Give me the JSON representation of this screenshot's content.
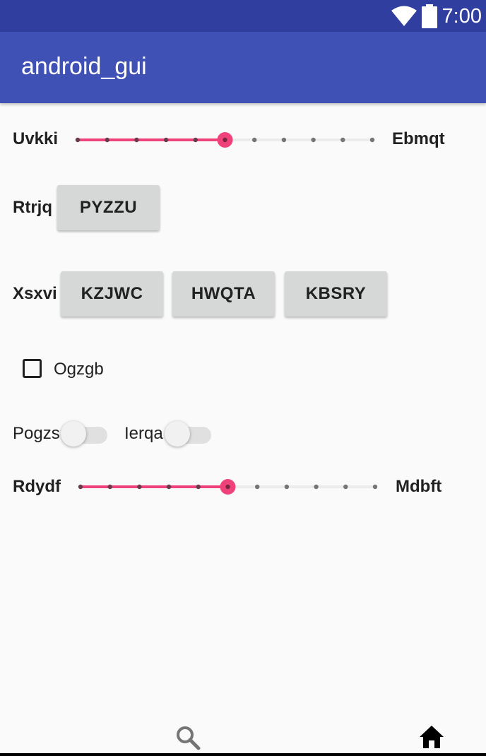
{
  "status_bar": {
    "time": "7:00",
    "wifi_icon": "wifi-icon",
    "battery_icon": "battery-icon"
  },
  "app_bar": {
    "title": "android_gui"
  },
  "slider1": {
    "left_label": "Uvkki",
    "right_label": "Ebmqt",
    "steps": 10,
    "value": 5,
    "accent": "#f0427a"
  },
  "button_row1": {
    "label": "Rtrjq",
    "buttons": [
      "PYZZU"
    ]
  },
  "button_row2": {
    "label": "Xsxvi",
    "buttons": [
      "KZJWC",
      "HWQTA",
      "KBSRY"
    ]
  },
  "checkbox": {
    "label": "Ogzgb",
    "checked": false
  },
  "switches": [
    {
      "label": "Pogzs",
      "on": false
    },
    {
      "label": "Ierqa",
      "on": false
    }
  ],
  "slider2": {
    "left_label": "Rdydf",
    "right_label": "Mdbft",
    "steps": 10,
    "value": 5,
    "accent": "#f0427a"
  },
  "bottom_nav": {
    "items": [
      "search-icon",
      "home-icon"
    ]
  }
}
